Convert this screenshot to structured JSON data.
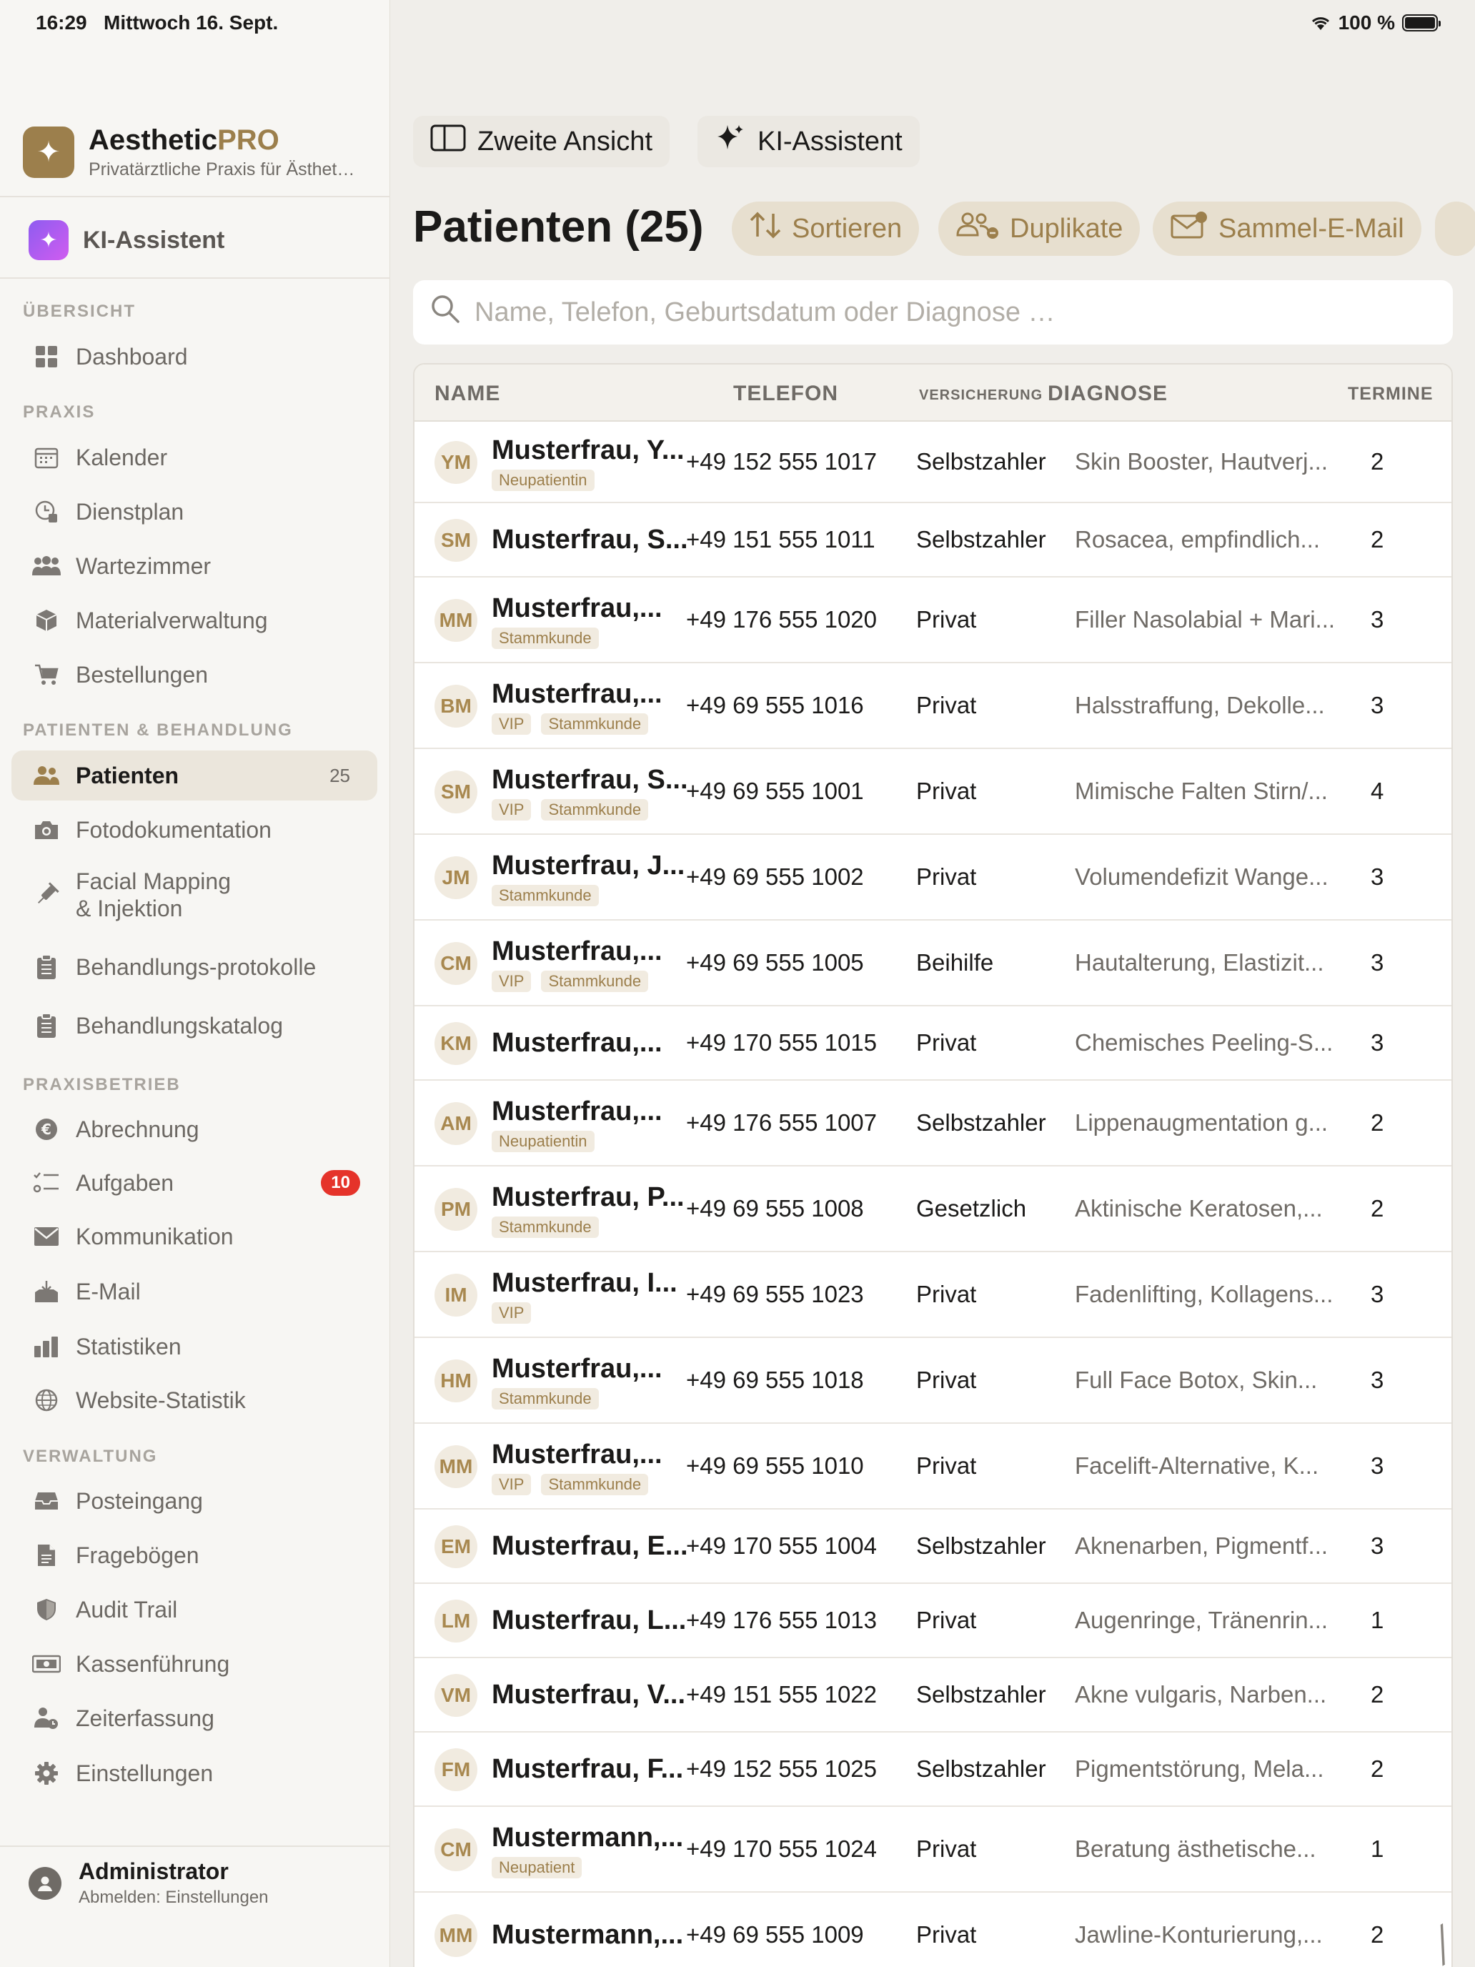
{
  "status_bar": {
    "time": "16:29",
    "date": "Mittwoch 16. Sept.",
    "battery": "100 %"
  },
  "brand": {
    "name": "Aesthetic",
    "name_accent": "PRO",
    "subtitle": "Privatärztliche Praxis für Ästhet…",
    "logo_icon": "sparkle-icon"
  },
  "ki_assistant": {
    "label": "KI-Assistent"
  },
  "sidebar": {
    "sections": {
      "overview": "ÜBERSICHT",
      "praxis": "PRAXIS",
      "patients": "PATIENTEN & BEHANDLUNG",
      "business": "PRAXISBETRIEB",
      "admin": "VERWALTUNG"
    },
    "items": {
      "dashboard": "Dashboard",
      "kalender": "Kalender",
      "dienstplan": "Dienstplan",
      "wartezimmer": "Wartezimmer",
      "material": "Materialverwaltung",
      "bestellungen": "Bestellungen",
      "patienten": "Patienten",
      "patienten_count": "25",
      "foto": "Fotodokumentation",
      "facial_1": "Facial Mapping",
      "facial_2": "& Injektion",
      "protokolle": "Behandlungs-protokolle",
      "katalog": "Behandlungskatalog",
      "abrechnung": "Abrechnung",
      "aufgaben": "Aufgaben",
      "aufgaben_badge": "10",
      "kommunikation": "Kommunikation",
      "email": "E-Mail",
      "statistiken": "Statistiken",
      "website": "Website-Statistik",
      "posteingang": "Posteingang",
      "frageboegen": "Fragebögen",
      "audit": "Audit Trail",
      "kasse": "Kassenführung",
      "zeit": "Zeiterfassung",
      "einstellungen": "Einstellungen"
    }
  },
  "user": {
    "name": "Administrator",
    "sub": "Abmelden: Einstellungen"
  },
  "toolbar": {
    "second_view": "Zweite Ansicht",
    "ki": "KI-Assistent"
  },
  "page": {
    "title": "Patienten (25)"
  },
  "actions": {
    "sort": "Sortieren",
    "duplicates": "Duplikate",
    "mass_mail": "Sammel-E-Mail"
  },
  "search": {
    "placeholder": "Name, Telefon, Geburtsdatum oder Diagnose …"
  },
  "table": {
    "headers": {
      "name": "NAME",
      "phone": "TELEFON",
      "insurance": "VERSICHERUNG",
      "diagnosis": "DIAGNOSE",
      "appointments": "TERMINE"
    },
    "rows": [
      {
        "initials": "YM",
        "name": "Musterfrau, Y...",
        "tags": [
          "Neupatientin"
        ],
        "phone": "+49 152 555 1017",
        "insurance": "Selbstzahler",
        "diagnosis": "Skin Booster, Hautverj...",
        "appointments": "2"
      },
      {
        "initials": "SM",
        "name": "Musterfrau, S...",
        "tags": [],
        "phone": "+49 151 555 1011",
        "insurance": "Selbstzahler",
        "diagnosis": "Rosacea, empfindlich...",
        "appointments": "2"
      },
      {
        "initials": "MM",
        "name": "Musterfrau,...",
        "tags": [
          "Stammkunde"
        ],
        "phone": "+49 176 555 1020",
        "insurance": "Privat",
        "diagnosis": "Filler Nasolabial + Mari...",
        "appointments": "3"
      },
      {
        "initials": "BM",
        "name": "Musterfrau,...",
        "tags": [
          "VIP",
          "Stammkunde"
        ],
        "phone": "+49 69 555 1016",
        "insurance": "Privat",
        "diagnosis": "Halsstraffung, Dekolle...",
        "appointments": "3"
      },
      {
        "initials": "SM",
        "name": "Musterfrau, S...",
        "tags": [
          "VIP",
          "Stammkunde"
        ],
        "phone": "+49 69 555 1001",
        "insurance": "Privat",
        "diagnosis": "Mimische Falten Stirn/...",
        "appointments": "4"
      },
      {
        "initials": "JM",
        "name": "Musterfrau, J...",
        "tags": [
          "Stammkunde"
        ],
        "phone": "+49 69 555 1002",
        "insurance": "Privat",
        "diagnosis": "Volumendefizit Wange...",
        "appointments": "3"
      },
      {
        "initials": "CM",
        "name": "Musterfrau,...",
        "tags": [
          "VIP",
          "Stammkunde"
        ],
        "phone": "+49 69 555 1005",
        "insurance": "Beihilfe",
        "diagnosis": "Hautalterung, Elastizit...",
        "appointments": "3"
      },
      {
        "initials": "KM",
        "name": "Musterfrau,...",
        "tags": [],
        "phone": "+49 170 555 1015",
        "insurance": "Privat",
        "diagnosis": "Chemisches Peeling-S...",
        "appointments": "3"
      },
      {
        "initials": "AM",
        "name": "Musterfrau,...",
        "tags": [
          "Neupatientin"
        ],
        "phone": "+49 176 555 1007",
        "insurance": "Selbstzahler",
        "diagnosis": "Lippenaugmentation g...",
        "appointments": "2"
      },
      {
        "initials": "PM",
        "name": "Musterfrau, P...",
        "tags": [
          "Stammkunde"
        ],
        "phone": "+49 69 555 1008",
        "insurance": "Gesetzlich",
        "diagnosis": "Aktinische Keratosen,...",
        "appointments": "2"
      },
      {
        "initials": "IM",
        "name": "Musterfrau, I...",
        "tags": [
          "VIP"
        ],
        "phone": "+49 69 555 1023",
        "insurance": "Privat",
        "diagnosis": "Fadenlifting, Kollagens...",
        "appointments": "3"
      },
      {
        "initials": "HM",
        "name": "Musterfrau,...",
        "tags": [
          "Stammkunde"
        ],
        "phone": "+49 69 555 1018",
        "insurance": "Privat",
        "diagnosis": "Full Face Botox, Skin...",
        "appointments": "3"
      },
      {
        "initials": "MM",
        "name": "Musterfrau,...",
        "tags": [
          "VIP",
          "Stammkunde"
        ],
        "phone": "+49 69 555 1010",
        "insurance": "Privat",
        "diagnosis": "Facelift-Alternative, K...",
        "appointments": "3"
      },
      {
        "initials": "EM",
        "name": "Musterfrau, E...",
        "tags": [],
        "phone": "+49 170 555 1004",
        "insurance": "Selbstzahler",
        "diagnosis": "Aknenarben, Pigmentf...",
        "appointments": "3"
      },
      {
        "initials": "LM",
        "name": "Musterfrau, L...",
        "tags": [],
        "phone": "+49 176 555 1013",
        "insurance": "Privat",
        "diagnosis": "Augenringe, Tränenrin...",
        "appointments": "1"
      },
      {
        "initials": "VM",
        "name": "Musterfrau, V...",
        "tags": [],
        "phone": "+49 151 555 1022",
        "insurance": "Selbstzahler",
        "diagnosis": "Akne vulgaris, Narben...",
        "appointments": "2"
      },
      {
        "initials": "FM",
        "name": "Musterfrau, F...",
        "tags": [],
        "phone": "+49 152 555 1025",
        "insurance": "Selbstzahler",
        "diagnosis": "Pigmentstörung, Mela...",
        "appointments": "2"
      },
      {
        "initials": "CM",
        "name": "Mustermann,...",
        "tags": [
          "Neupatient"
        ],
        "phone": "+49 170 555 1024",
        "insurance": "Privat",
        "diagnosis": "Beratung ästhetische...",
        "appointments": "1"
      },
      {
        "initials": "MM",
        "name": "Mustermann,...",
        "tags": [],
        "phone": "+49 69 555 1009",
        "insurance": "Privat",
        "diagnosis": "Jawline-Konturierung,...",
        "appointments": "2"
      }
    ]
  }
}
